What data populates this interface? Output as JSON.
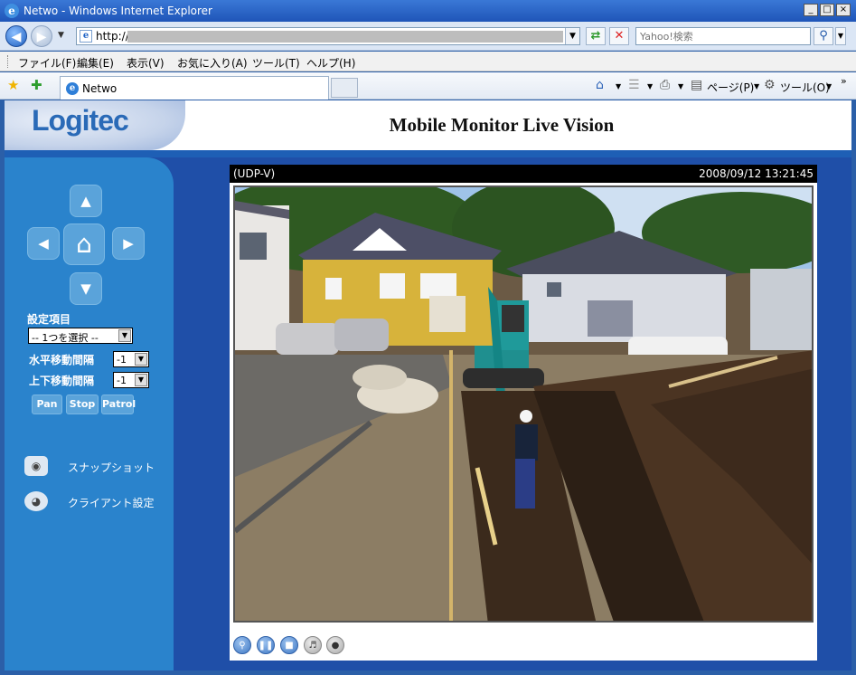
{
  "window": {
    "title": "Netwo - Windows Internet Explorer",
    "controls": [
      "_",
      "□",
      "×"
    ]
  },
  "address": {
    "url_prefix": "http://",
    "search_placeholder": "Yahoo!検索"
  },
  "menu": [
    "ファイル(F)",
    "編集(E)",
    "表示(V)",
    "お気に入り(A)",
    "ツール(T)",
    "ヘルプ(H)"
  ],
  "tab": {
    "title": "Netwo"
  },
  "commandbar": {
    "page_label": "ページ(P)",
    "tools_label": "ツール(O)"
  },
  "site": {
    "logo": "Logitec",
    "title": "Mobile Monitor Live Vision"
  },
  "sidebar": {
    "settings_label": "設定項目",
    "settings_select": "-- 1つを選択 --",
    "horizontal_label": "水平移動間隔",
    "horizontal_value": "-1",
    "vertical_label": "上下移動間隔",
    "vertical_value": "-1",
    "buttons": [
      "Pan",
      "Stop",
      "Patrol"
    ],
    "links": [
      "スナップショット",
      "クライアント設定"
    ]
  },
  "viewer": {
    "channel": "(UDP-V)",
    "timestamp": "2008/09/12 13:21:45"
  },
  "icons": {
    "back": "arrow-left-icon",
    "forward": "arrow-right-icon",
    "refresh": "refresh-icon",
    "stop": "stop-icon",
    "search": "magnifier-icon",
    "favorites": "star-icon",
    "add_favorite": "add-star-icon",
    "home": "home-icon",
    "feeds": "rss-icon",
    "print": "printer-icon",
    "ptz_up": "arrow-up-icon",
    "ptz_down": "arrow-down-icon",
    "ptz_left": "arrow-left-icon",
    "ptz_right": "arrow-right-icon",
    "ptz_home": "home-icon",
    "snapshot": "camera-icon",
    "client_settings": "disc-icon",
    "zoom": "zoom-icon",
    "pause": "pause-icon",
    "stop_video": "stop-icon",
    "speaker": "speaker-icon",
    "mic": "microphone-icon"
  },
  "colors": {
    "page_bg": "#1f4fa8",
    "sidebar": "#2a83cc",
    "accent": "#2a6ab7"
  }
}
